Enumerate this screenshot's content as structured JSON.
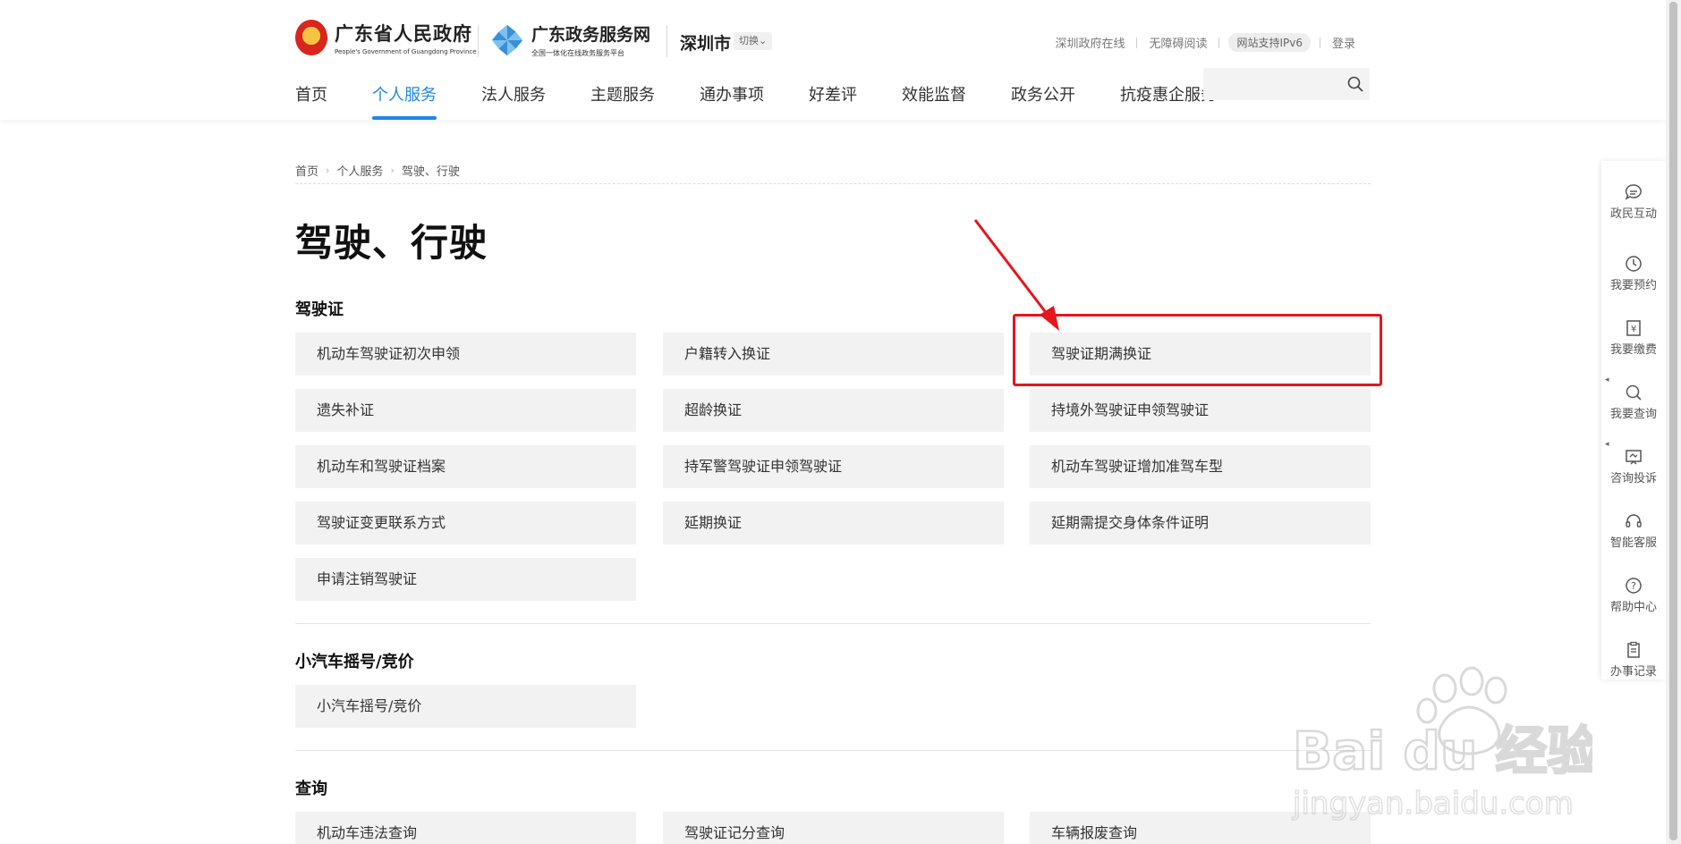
{
  "header": {
    "gov_logo_cn": "广东省人民政府",
    "gov_logo_en": "People's Government of Guangdong Province",
    "service_logo_cn": "广东政务服务网",
    "service_logo_sub": "全国一体化在线政务服务平台",
    "city": "深圳市",
    "switch_label": "切换⌄",
    "top_links": [
      "深圳政府在线",
      "无障碍阅读",
      "网站支持IPv6",
      "登录"
    ],
    "nav": [
      "首页",
      "个人服务",
      "法人服务",
      "主题服务",
      "通办事项",
      "好差评",
      "效能监督",
      "政务公开",
      "抗疫惠企服务"
    ],
    "active_nav": "个人服务",
    "search_placeholder": ""
  },
  "breadcrumb": [
    "首页",
    "个人服务",
    "驾驶、行驶"
  ],
  "page_title": "驾驶、行驶",
  "sections": [
    {
      "title": "驾驶证",
      "items": [
        "机动车驾驶证初次申领",
        "户籍转入换证",
        "驾驶证期满换证",
        "遗失补证",
        "超龄换证",
        "持境外驾驶证申领驾驶证",
        "机动车和驾驶证档案",
        "持军警驾驶证申领驾驶证",
        "机动车驾驶证增加准驾车型",
        "驾驶证变更联系方式",
        "延期换证",
        "延期需提交身体条件证明",
        "申请注销驾驶证"
      ]
    },
    {
      "title": "小汽车摇号/竞价",
      "items": [
        "小汽车摇号/竞价"
      ]
    },
    {
      "title": "查询",
      "items": [
        "机动车违法查询",
        "驾驶证记分查询",
        "车辆报废查询"
      ]
    }
  ],
  "highlighted_item": "驾驶证期满换证",
  "sidebar": [
    "政民互动",
    "我要预约",
    "我要缴费",
    "我要查询",
    "咨询投诉",
    "智能客服",
    "帮助中心",
    "办事记录"
  ],
  "colors": {
    "accent": "#1f88e5",
    "highlight": "#e5161d",
    "tile_bg": "#f2f2f2"
  },
  "watermark": {
    "brand": "Bai du 经验",
    "url": "jingyan.baidu.com"
  }
}
